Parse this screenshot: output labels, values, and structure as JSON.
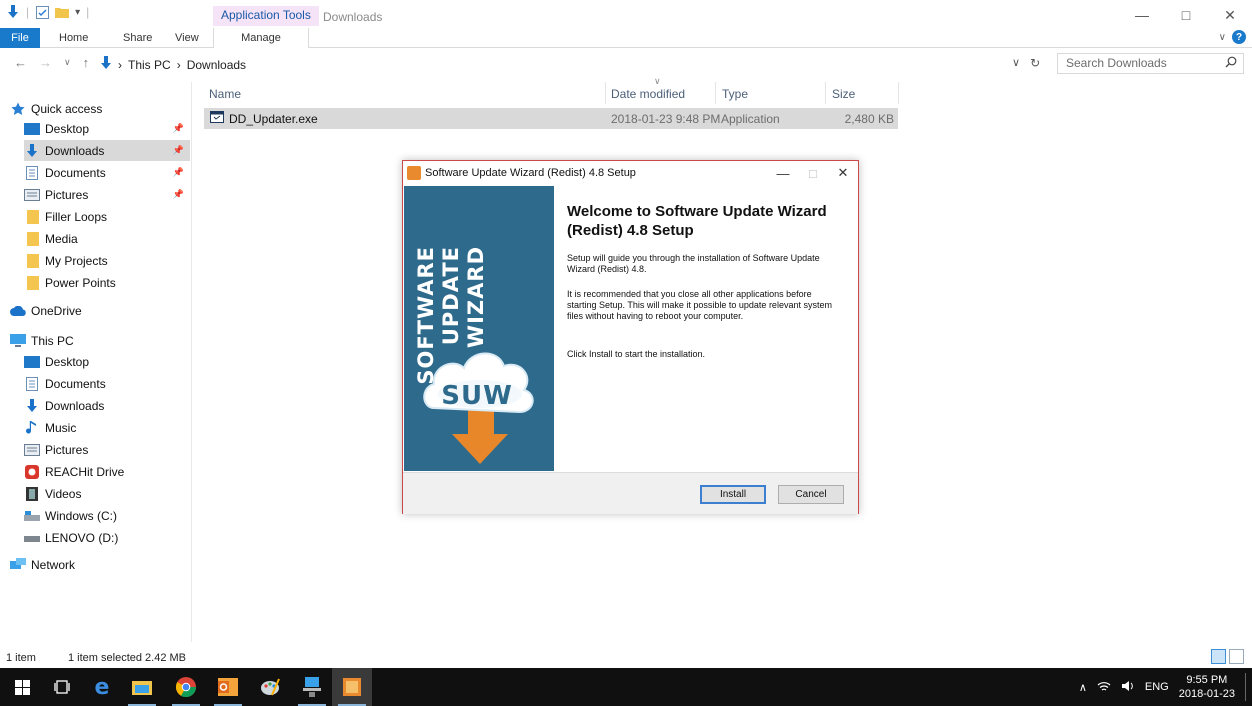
{
  "window": {
    "title": "Downloads",
    "contextual_tab_header": "Application Tools",
    "ribbon_tabs": [
      "File",
      "Home",
      "Share",
      "View",
      "Manage"
    ],
    "controls": {
      "minimize": "—",
      "maximize": "□",
      "close": "✕"
    }
  },
  "address": {
    "crumbs": [
      "This PC",
      "Downloads"
    ],
    "search_placeholder": "Search Downloads"
  },
  "nav": {
    "quick_access": "Quick access",
    "quick_items": [
      "Desktop",
      "Downloads",
      "Documents",
      "Pictures",
      "Filler Loops",
      "Media",
      "My Projects",
      "Power Points"
    ],
    "onedrive": "OneDrive",
    "this_pc": "This PC",
    "pc_items": [
      "Desktop",
      "Documents",
      "Downloads",
      "Music",
      "Pictures",
      "REACHit Drive",
      "Videos",
      "Windows (C:)",
      "LENOVO (D:)"
    ],
    "network": "Network"
  },
  "columns": {
    "name": "Name",
    "date": "Date modified",
    "type": "Type",
    "size": "Size"
  },
  "files": [
    {
      "name": "DD_Updater.exe",
      "date": "2018-01-23 9:48 PM",
      "type": "Application",
      "size": "2,480 KB"
    }
  ],
  "status": {
    "count": "1 item",
    "selected": "1 item selected  2.42 MB"
  },
  "dialog": {
    "title": "Software Update Wizard (Redist) 4.8 Setup",
    "banner_lines": [
      "SOFTWARE",
      "UPDATE",
      "WIZARD"
    ],
    "logo_text": "SUW",
    "heading": "Welcome to Software Update Wizard (Redist) 4.8 Setup",
    "para1": "Setup will guide you through the installation of Software Update Wizard (Redist) 4.8.",
    "para2": "It is recommended that you close all other applications before starting Setup. This will make it possible to update relevant system files without having to reboot your computer.",
    "para3": "Click Install to start the installation.",
    "install_label": "Install",
    "cancel_label": "Cancel",
    "colors": {
      "banner": "#2e6a8c",
      "arrow": "#e8862a"
    }
  },
  "taskbar": {
    "time": "9:55 PM",
    "date": "2018-01-23",
    "language": "ENG",
    "icons": [
      "start-icon",
      "task-view-icon",
      "edge-icon",
      "file-explorer-icon",
      "chrome-icon",
      "outlook-icon",
      "paint-icon",
      "network-tool-icon",
      "installer-icon"
    ]
  }
}
